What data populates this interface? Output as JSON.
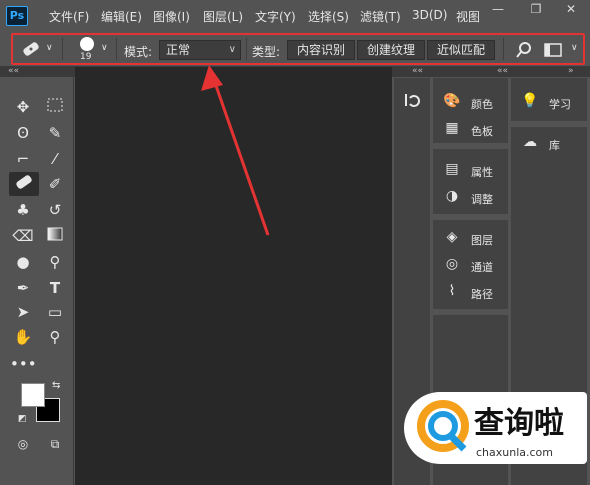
{
  "app": {
    "logo": "Ps"
  },
  "menu": [
    "文件(F)",
    "编辑(E)",
    "图像(I)",
    "图层(L)",
    "文字(Y)",
    "选择(S)",
    "滤镜(T)",
    "3D(D)",
    "视图"
  ],
  "window_buttons": [
    "—",
    "❐",
    "✕"
  ],
  "options_bar": {
    "brush_size": "19",
    "mode_label": "模式:",
    "mode_value": "正常",
    "type_label": "类型:",
    "type_options": [
      "内容识别",
      "创建纹理",
      "近似匹配"
    ]
  },
  "panels": {
    "collapse_glyph": "««",
    "group1": [
      "颜色",
      "色板"
    ],
    "group2": [
      "属性",
      "调整"
    ],
    "group3": [
      "图层",
      "通道",
      "路径"
    ],
    "group4": [
      "学习",
      "库"
    ]
  },
  "watermark": {
    "title": "查询啦",
    "url": "chaxunla.com"
  },
  "colors": {
    "annotation": "#e53333",
    "canvas": "#282828",
    "ui": "#535353"
  }
}
